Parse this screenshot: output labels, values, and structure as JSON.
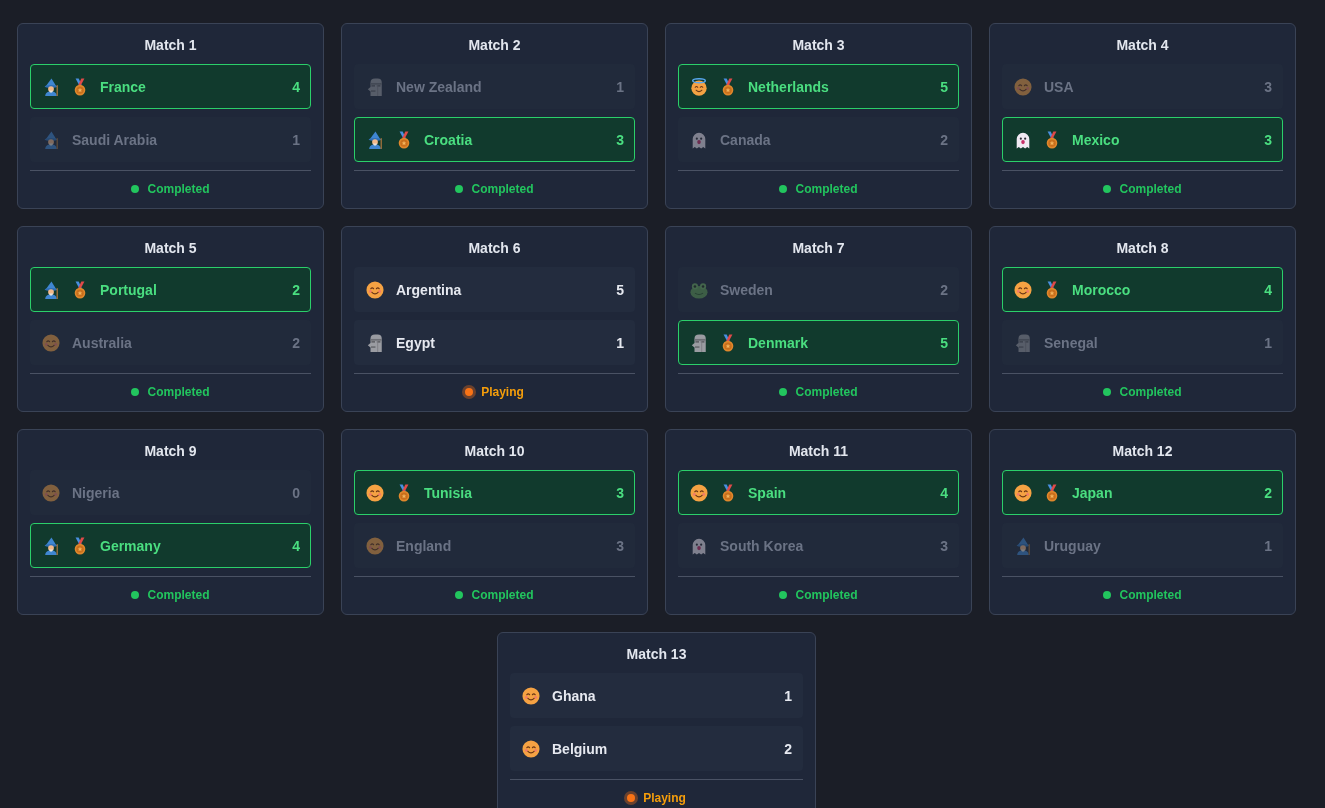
{
  "matches": [
    {
      "title": "Match 1",
      "teams": [
        {
          "name": "France",
          "score": "4",
          "kind": "wizard",
          "winner": true
        },
        {
          "name": "Saudi Arabia",
          "score": "1",
          "kind": "wizard",
          "winner": false
        }
      ],
      "status": {
        "label": "Completed",
        "kind": "completed"
      }
    },
    {
      "title": "Match 2",
      "teams": [
        {
          "name": "New Zealand",
          "score": "1",
          "kind": "moai",
          "winner": false
        },
        {
          "name": "Croatia",
          "score": "3",
          "kind": "wizard",
          "winner": true
        }
      ],
      "status": {
        "label": "Completed",
        "kind": "completed"
      }
    },
    {
      "title": "Match 3",
      "teams": [
        {
          "name": "Netherlands",
          "score": "5",
          "kind": "halo",
          "winner": true
        },
        {
          "name": "Canada",
          "score": "2",
          "kind": "ghost",
          "winner": false
        }
      ],
      "status": {
        "label": "Completed",
        "kind": "completed"
      }
    },
    {
      "title": "Match 4",
      "teams": [
        {
          "name": "USA",
          "score": "3",
          "kind": "smile",
          "winner": false
        },
        {
          "name": "Mexico",
          "score": "3",
          "kind": "ghost",
          "winner": true
        }
      ],
      "status": {
        "label": "Completed",
        "kind": "completed"
      }
    },
    {
      "title": "Match 5",
      "teams": [
        {
          "name": "Portugal",
          "score": "2",
          "kind": "wizard",
          "winner": true
        },
        {
          "name": "Australia",
          "score": "2",
          "kind": "smile",
          "winner": false
        }
      ],
      "status": {
        "label": "Completed",
        "kind": "completed"
      }
    },
    {
      "title": "Match 6",
      "teams": [
        {
          "name": "Argentina",
          "score": "5",
          "kind": "smile",
          "winner": false
        },
        {
          "name": "Egypt",
          "score": "1",
          "kind": "moai",
          "winner": false
        }
      ],
      "status": {
        "label": "Playing",
        "kind": "playing"
      }
    },
    {
      "title": "Match 7",
      "teams": [
        {
          "name": "Sweden",
          "score": "2",
          "kind": "frog",
          "winner": false
        },
        {
          "name": "Denmark",
          "score": "5",
          "kind": "moai",
          "winner": true
        }
      ],
      "status": {
        "label": "Completed",
        "kind": "completed"
      }
    },
    {
      "title": "Match 8",
      "teams": [
        {
          "name": "Morocco",
          "score": "4",
          "kind": "smile",
          "winner": true
        },
        {
          "name": "Senegal",
          "score": "1",
          "kind": "moai",
          "winner": false
        }
      ],
      "status": {
        "label": "Completed",
        "kind": "completed"
      }
    },
    {
      "title": "Match 9",
      "teams": [
        {
          "name": "Nigeria",
          "score": "0",
          "kind": "smile",
          "winner": false
        },
        {
          "name": "Germany",
          "score": "4",
          "kind": "wizard",
          "winner": true
        }
      ],
      "status": {
        "label": "Completed",
        "kind": "completed"
      }
    },
    {
      "title": "Match 10",
      "teams": [
        {
          "name": "Tunisia",
          "score": "3",
          "kind": "smile",
          "winner": true
        },
        {
          "name": "England",
          "score": "3",
          "kind": "smile",
          "winner": false
        }
      ],
      "status": {
        "label": "Completed",
        "kind": "completed"
      }
    },
    {
      "title": "Match 11",
      "teams": [
        {
          "name": "Spain",
          "score": "4",
          "kind": "smile",
          "winner": true
        },
        {
          "name": "South Korea",
          "score": "3",
          "kind": "ghost",
          "winner": false
        }
      ],
      "status": {
        "label": "Completed",
        "kind": "completed"
      }
    },
    {
      "title": "Match 12",
      "teams": [
        {
          "name": "Japan",
          "score": "2",
          "kind": "smile",
          "winner": true
        },
        {
          "name": "Uruguay",
          "score": "1",
          "kind": "wizard",
          "winner": false
        }
      ],
      "status": {
        "label": "Completed",
        "kind": "completed"
      }
    },
    {
      "title": "Match 13",
      "teams": [
        {
          "name": "Ghana",
          "score": "1",
          "kind": "smile",
          "winner": false
        },
        {
          "name": "Belgium",
          "score": "2",
          "kind": "smile",
          "winner": false
        }
      ],
      "status": {
        "label": "Playing",
        "kind": "playing"
      }
    }
  ]
}
